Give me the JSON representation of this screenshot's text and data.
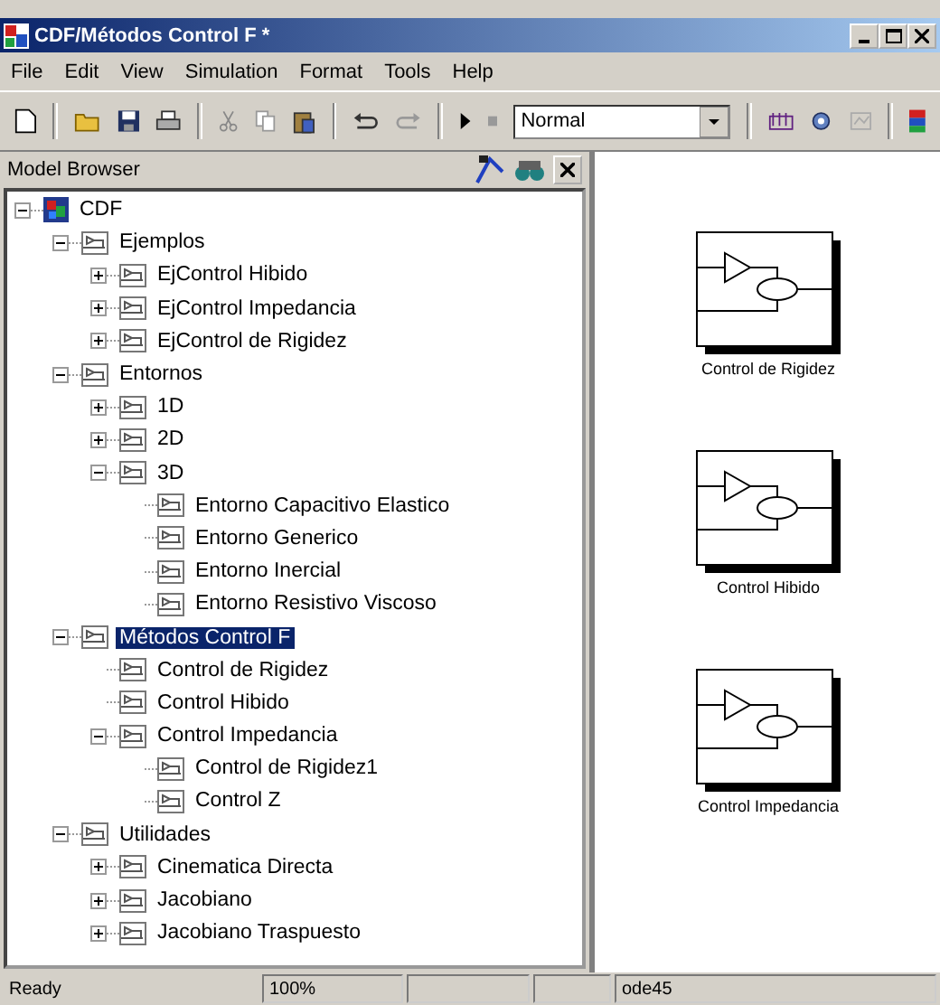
{
  "window": {
    "title": "CDF/Métodos Control F *"
  },
  "menu": [
    "File",
    "Edit",
    "View",
    "Simulation",
    "Format",
    "Tools",
    "Help"
  ],
  "toolbar": {
    "sim_mode": "Normal"
  },
  "model_browser": {
    "title": "Model Browser",
    "tree": [
      {
        "label": "CDF",
        "kind": "model",
        "expanded": true,
        "selected": false,
        "children": [
          {
            "label": "Ejemplos",
            "kind": "subsystem",
            "expanded": true,
            "selected": false,
            "children": [
              {
                "label": "EjControl Hibido",
                "kind": "subsystem",
                "expanded": false,
                "selected": false
              },
              {
                "label": "EjControl Impedancia",
                "kind": "subsystem",
                "expanded": false,
                "selected": false
              },
              {
                "label": "EjControl de Rigidez",
                "kind": "subsystem",
                "expanded": false,
                "selected": false
              }
            ]
          },
          {
            "label": "Entornos",
            "kind": "subsystem",
            "expanded": true,
            "selected": false,
            "children": [
              {
                "label": "1D",
                "kind": "subsystem",
                "expanded": false,
                "selected": false
              },
              {
                "label": "2D",
                "kind": "subsystem",
                "expanded": false,
                "selected": false
              },
              {
                "label": "3D",
                "kind": "subsystem",
                "expanded": true,
                "selected": false,
                "children": [
                  {
                    "label": "Entorno Capacitivo Elastico",
                    "kind": "subsystem",
                    "selected": false
                  },
                  {
                    "label": "Entorno Generico",
                    "kind": "subsystem",
                    "selected": false
                  },
                  {
                    "label": "Entorno Inercial",
                    "kind": "subsystem",
                    "selected": false
                  },
                  {
                    "label": "Entorno Resistivo Viscoso",
                    "kind": "subsystem",
                    "selected": false
                  }
                ]
              }
            ]
          },
          {
            "label": "Métodos Control F",
            "kind": "subsystem",
            "expanded": true,
            "selected": true,
            "children": [
              {
                "label": "Control de Rigidez",
                "kind": "subsystem",
                "selected": false
              },
              {
                "label": "Control Hibido",
                "kind": "subsystem",
                "selected": false
              },
              {
                "label": "Control Impedancia",
                "kind": "subsystem",
                "expanded": true,
                "selected": false,
                "children": [
                  {
                    "label": "Control de Rigidez1",
                    "kind": "subsystem",
                    "selected": false
                  },
                  {
                    "label": "Control Z",
                    "kind": "subsystem",
                    "selected": false
                  }
                ]
              }
            ]
          },
          {
            "label": "Utilidades",
            "kind": "subsystem",
            "expanded": true,
            "selected": false,
            "children": [
              {
                "label": "Cinematica Directa",
                "kind": "subsystem",
                "expanded": false,
                "selected": false
              },
              {
                "label": "Jacobiano",
                "kind": "subsystem",
                "expanded": false,
                "selected": false
              },
              {
                "label": "Jacobiano Traspuesto",
                "kind": "subsystem",
                "expanded": false,
                "selected": false
              }
            ]
          }
        ]
      }
    ]
  },
  "canvas": {
    "blocks": [
      {
        "label": "Control de Rigidez"
      },
      {
        "label": "Control Hibido"
      },
      {
        "label": "Control Impedancia"
      }
    ]
  },
  "status_bar": {
    "status": "Ready",
    "zoom": "100%",
    "solver": "ode45"
  }
}
